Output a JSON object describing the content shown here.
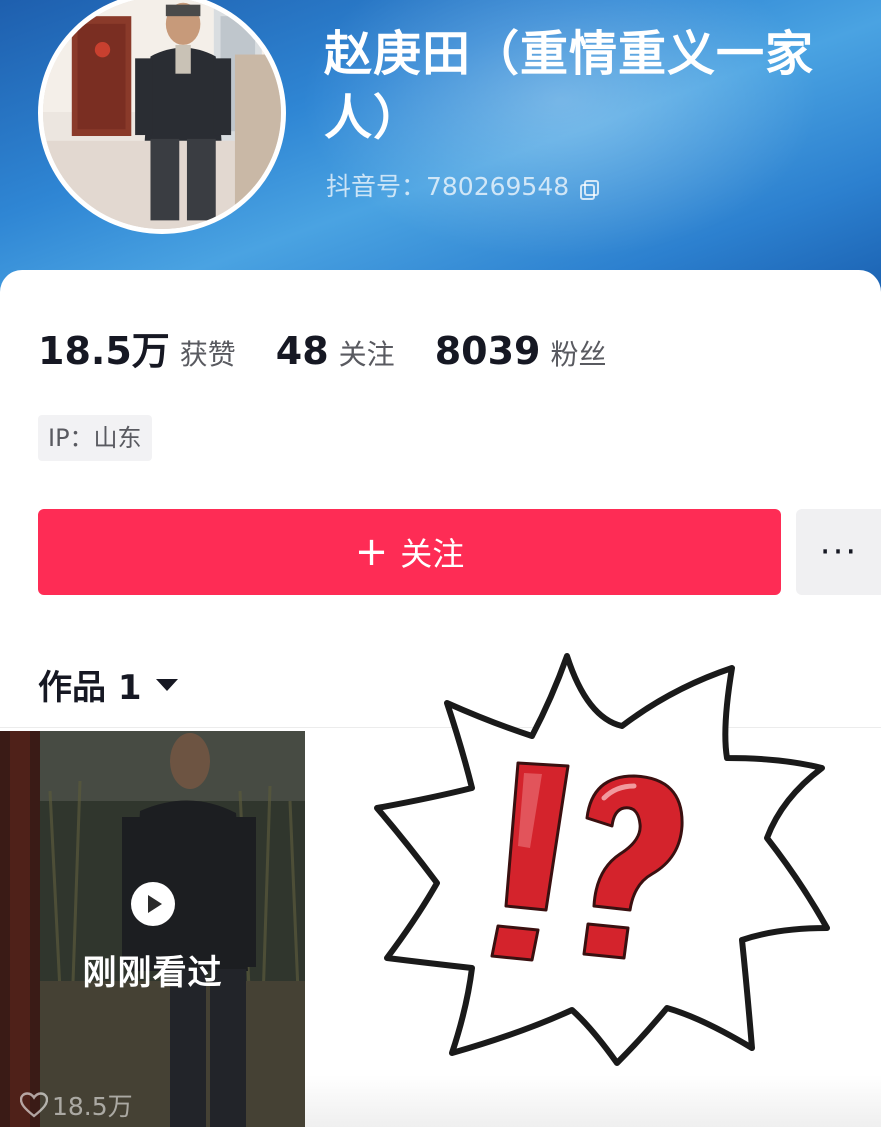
{
  "profile": {
    "name": "赵庚田（重情重义一家人）",
    "douyin_id": "抖音号：780269548"
  },
  "stats": [
    {
      "value": "18.5万",
      "label": "获赞"
    },
    {
      "value": "48",
      "label": "关注"
    },
    {
      "value": "8039",
      "label": "粉丝"
    }
  ],
  "ip_tag": "IP：山东",
  "actions": {
    "follow_label": "关注",
    "follow_icon": "+",
    "more_icon": "···"
  },
  "works_tab": {
    "label": "作品 1"
  },
  "videos": [
    {
      "overlay_text": "刚刚看过",
      "likes": "18.5万"
    }
  ],
  "colors": {
    "accent": "#fe2c55",
    "header_blue": "#2f86d4",
    "sticker_red": "#d4232c"
  },
  "icons": [
    "copy-icon",
    "plus-icon",
    "more-icon",
    "caret-down-icon",
    "play-icon",
    "heart-icon",
    "exclamation-question-sticker"
  ]
}
